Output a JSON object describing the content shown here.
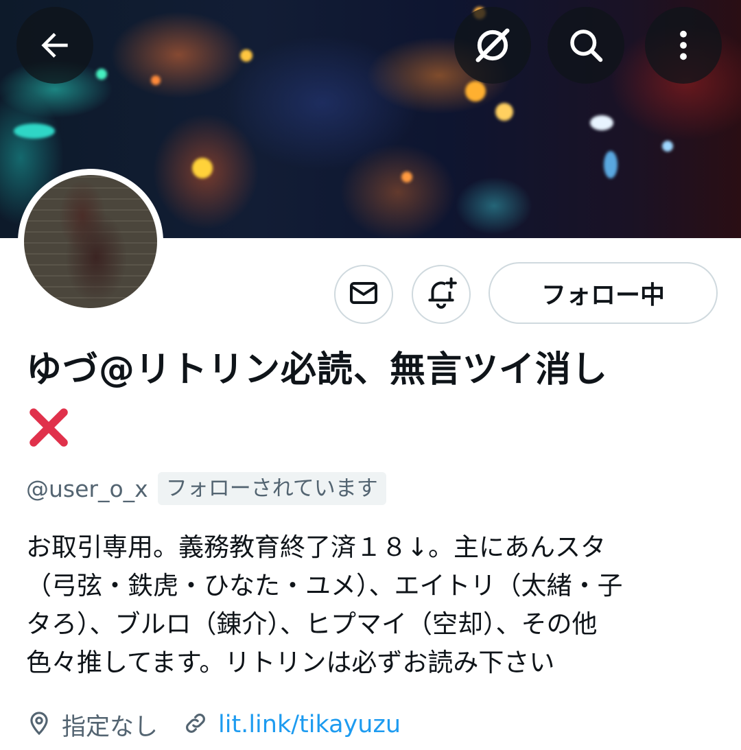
{
  "header": {
    "back_icon": "arrow-left-icon",
    "grok_icon": "grok-icon",
    "search_icon": "search-icon",
    "more_icon": "more-vertical-icon"
  },
  "actions": {
    "message_icon": "envelope-icon",
    "notify_icon": "bell-plus-icon",
    "follow_label": "フォロー中"
  },
  "profile": {
    "display_name": "ゆづ@リトリン必読、無言ツイ消し",
    "name_emoji": "cross-mark-emoji",
    "handle": "@user_o_x",
    "follows_you": "フォローされています",
    "bio_lines": [
      "お取引専用。義務教育終了済１８↓。主にあんスタ",
      "（弓弦・鉄虎・ひなた・ユメ）、エイトリ（太緒・子",
      "タろ）、ブルロ（錬介）、ヒプマイ（空却）、その他",
      "色々推してます。リトリンは必ずお読み下さい"
    ],
    "location": "指定なし",
    "link": "lit.link/tikayuzu"
  },
  "colors": {
    "text_primary": "#0f1419",
    "text_secondary": "#536471",
    "link": "#1d9bf0",
    "border": "#cfd9de",
    "badge_bg": "#eff3f4",
    "cross_red": "#e0314b"
  }
}
